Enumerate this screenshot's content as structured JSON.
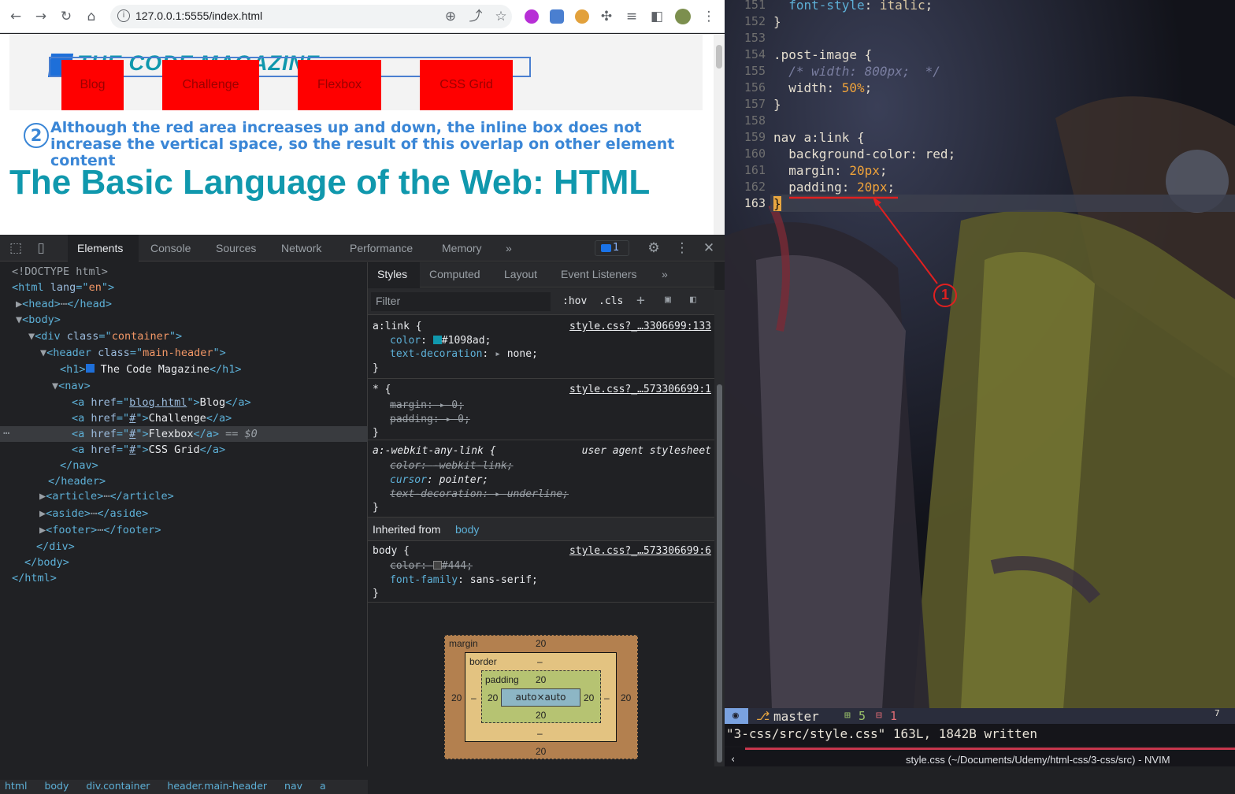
{
  "browser": {
    "url": "127.0.0.1:5555/index.html"
  },
  "page": {
    "logo_text": "THE CODE MAGAZINE",
    "nav": [
      "Blog",
      "Challenge",
      "Flexbox",
      "CSS Grid"
    ],
    "annotation_number": "2",
    "annotation_text": "Although the red area increases up and down, the inline box does not increase the vertical space, so the result of this overlap on other element content",
    "heading": "The Basic Language of the Web: HTML"
  },
  "devtools": {
    "tabs": [
      "Elements",
      "Console",
      "Sources",
      "Network",
      "Performance",
      "Memory"
    ],
    "more": "»",
    "issues_count": "1",
    "elements": {
      "doctype": "<!DOCTYPE html>",
      "html_open": "<html lang=\"en\">",
      "head": "head",
      "body": "body",
      "div_class": "container",
      "header_class": "main-header",
      "h1_text": "The Code Magazine",
      "a1_href": "blog.html",
      "a1_text": "Blog",
      "a2_href": "#",
      "a2_text": "Challenge",
      "a3_href": "#",
      "a3_text": "Flexbox",
      "a3_suffix": " == $0",
      "a4_href": "#",
      "a4_text": "CSS Grid",
      "article": "article",
      "aside": "aside",
      "footer": "footer"
    },
    "breadcrumbs": [
      "html",
      "body",
      "div.container",
      "header.main-header",
      "nav",
      "a"
    ],
    "styles": {
      "tabs": [
        "Styles",
        "Computed",
        "Layout",
        "Event Listeners"
      ],
      "filter_placeholder": "Filter",
      "hov": ":hov",
      "cls": ".cls",
      "rules": [
        {
          "selector": "a:link {",
          "source": "style.css?_…3306699:133",
          "props": [
            {
              "name": "color",
              "value": "#1098ad",
              "swatch": "#1098ad"
            },
            {
              "name": "text-decoration",
              "value": "none"
            }
          ]
        },
        {
          "selector": "* {",
          "source": "style.css?_…573306699:1",
          "props": [
            {
              "name": "margin",
              "value": "0"
            },
            {
              "name": "padding",
              "value": "0"
            }
          ]
        },
        {
          "selector": "a:-webkit-any-link {",
          "source": "user agent stylesheet",
          "props": [
            {
              "name": "color",
              "value": "-webkit-link"
            },
            {
              "name": "cursor",
              "value": "pointer"
            },
            {
              "name": "text-decoration",
              "value": "underline"
            }
          ]
        }
      ],
      "inherited_label": "Inherited from",
      "inherited_from": "body",
      "body_rule": {
        "selector": "body {",
        "source": "style.css?_…573306699:6",
        "props": [
          {
            "name": "color",
            "value": "#444",
            "swatch": "#444444"
          },
          {
            "name": "font-family",
            "value": "sans-serif"
          }
        ]
      },
      "closing_brace": "}"
    },
    "box_model": {
      "margin_label": "margin",
      "margin": "20",
      "border_label": "border",
      "border": "–",
      "padding_label": "padding",
      "padding": "20",
      "content": "auto×auto"
    }
  },
  "editor": {
    "lines": [
      {
        "n": "151",
        "text": "  font-style: italic;"
      },
      {
        "n": "152",
        "text": "}"
      },
      {
        "n": "153",
        "text": ""
      },
      {
        "n": "154",
        "text": ".post-image {"
      },
      {
        "n": "155",
        "text": "  /* width: 800px;  */"
      },
      {
        "n": "156",
        "text": "  width: 50%;"
      },
      {
        "n": "157",
        "text": "}"
      },
      {
        "n": "158",
        "text": ""
      },
      {
        "n": "159",
        "text": "nav a:link {"
      },
      {
        "n": "160",
        "text": "  background-color: red;"
      },
      {
        "n": "161",
        "text": "  margin: 20px;"
      },
      {
        "n": "162",
        "text": "  padding: 20px;"
      },
      {
        "n": "163",
        "text": "}"
      }
    ],
    "annotation_number": "1",
    "status": {
      "branch_icon": "⎇",
      "branch": "master",
      "added": "5",
      "removed": "1",
      "right_marker": "7"
    },
    "cmdline": "\"3-css/src/style.css\" 163L, 1842B written",
    "window_title": "style.css (~/Documents/Udemy/html-css/3-css/src) - NVIM"
  }
}
